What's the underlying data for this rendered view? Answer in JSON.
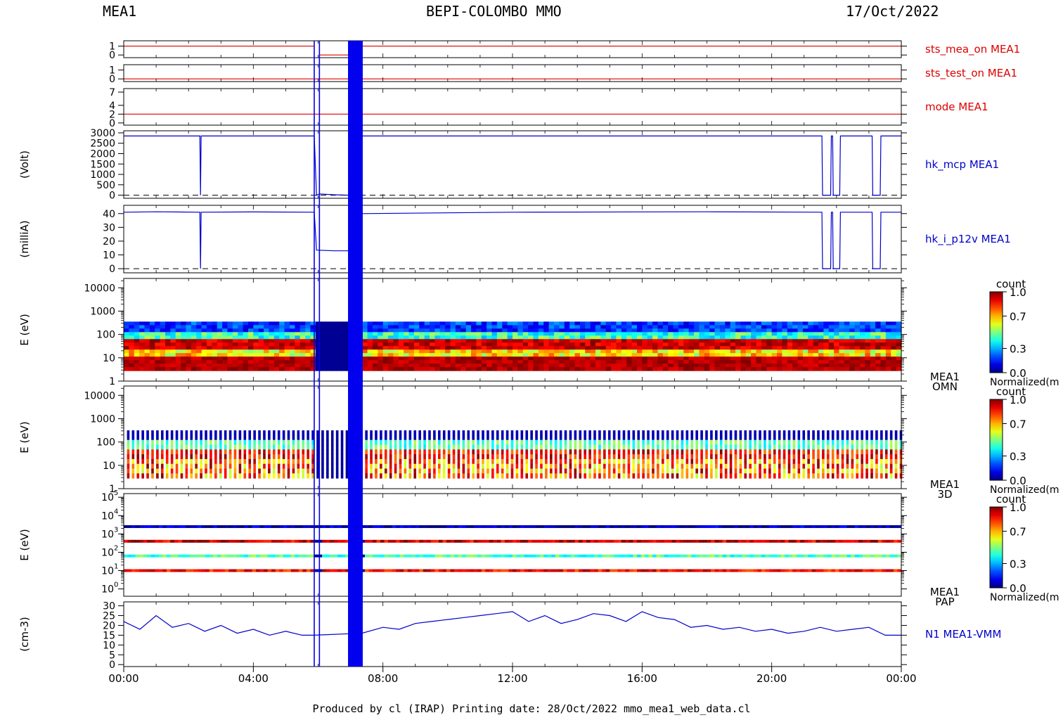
{
  "header": {
    "left": "MEA1",
    "center": "BEPI-COLOMBO MMO",
    "right": "17/Oct/2022"
  },
  "footer": {
    "text": "Produced by cl (IRAP)    Printing date: 28/Oct/2022    mmo_mea1_web_data.cl"
  },
  "colors": {
    "status_line": "#dd0000",
    "hk_line": "#0000cc",
    "event_marker": "#0000ee",
    "frame": "#000000"
  },
  "chart_data": {
    "type": "line",
    "x_axis": {
      "range_hours": [
        0,
        24
      ],
      "tick_hours": [
        0,
        4,
        8,
        12,
        16,
        20,
        24
      ],
      "tick_labels": [
        "00:00",
        "04:00",
        "08:00",
        "12:00",
        "16:00",
        "20:00",
        "00:00"
      ]
    },
    "event_markers_hours": [
      5.88,
      6.04,
      6.95,
      7.0,
      7.05,
      7.1,
      7.15,
      7.2,
      7.25,
      7.3,
      7.35
    ],
    "panels": [
      {
        "id": "sts_mea_on",
        "kind": "status",
        "label": "sts_mea_on MEA1",
        "label_color": "#dd0000",
        "ylabel": "",
        "ylim": [
          -0.3,
          1.6
        ],
        "ticks": [
          1,
          0
        ],
        "tick_labels": [
          "1",
          "0"
        ],
        "segments": [
          {
            "x": [
              0,
              5.88
            ],
            "y": 1
          },
          {
            "x": [
              6.04,
              6.95
            ],
            "y": 0
          },
          {
            "x": [
              7.35,
              24
            ],
            "y": 1
          }
        ]
      },
      {
        "id": "sts_test_on",
        "kind": "status",
        "label": "sts_test_on MEA1",
        "label_color": "#dd0000",
        "ylabel": "",
        "ylim": [
          -0.3,
          1.6
        ],
        "ticks": [
          1,
          0
        ],
        "tick_labels": [
          "1",
          "0"
        ],
        "segments": [
          {
            "x": [
              0,
              24
            ],
            "y": 0
          }
        ]
      },
      {
        "id": "mode",
        "kind": "status",
        "label": "mode MEA1",
        "label_color": "#dd0000",
        "ylabel": "",
        "ylim": [
          -0.5,
          7.8
        ],
        "ticks": [
          7,
          4,
          2,
          0
        ],
        "tick_labels": [
          "7",
          "4",
          "2",
          "0"
        ],
        "segments": [
          {
            "x": [
              0,
              24
            ],
            "y": 2
          }
        ]
      },
      {
        "id": "hk_mcp",
        "kind": "line",
        "label": "hk_mcp MEA1",
        "label_color": "#0000cc",
        "ylabel": "(Volt)",
        "ylim": [
          -150,
          3100
        ],
        "ticks": [
          3000,
          2500,
          2000,
          1500,
          1000,
          500,
          0
        ],
        "tick_labels": [
          "3000",
          "2500",
          "2000",
          "1500",
          "1000",
          "500",
          "0"
        ],
        "baseline": 0,
        "points": [
          [
            0,
            2850
          ],
          [
            2.35,
            2850
          ],
          [
            2.37,
            0
          ],
          [
            2.39,
            2850
          ],
          [
            5.88,
            2850
          ],
          [
            5.95,
            0
          ],
          [
            6.04,
            60
          ],
          [
            6.5,
            20
          ],
          [
            6.95,
            0
          ],
          [
            7.35,
            2850
          ],
          [
            21.55,
            2850
          ],
          [
            21.57,
            0
          ],
          [
            21.82,
            0
          ],
          [
            21.84,
            2850
          ],
          [
            21.88,
            2850
          ],
          [
            21.9,
            0
          ],
          [
            22.1,
            0
          ],
          [
            22.12,
            2850
          ],
          [
            23.1,
            2850
          ],
          [
            23.12,
            0
          ],
          [
            23.35,
            0
          ],
          [
            23.37,
            2850
          ],
          [
            24,
            2850
          ]
        ]
      },
      {
        "id": "hk_i_p12v",
        "kind": "line",
        "label": "hk_i_p12v MEA1",
        "label_color": "#0000cc",
        "ylabel": "(milliA)",
        "ylim": [
          -3,
          46
        ],
        "ticks": [
          40,
          30,
          20,
          10,
          0
        ],
        "tick_labels": [
          "40",
          "30",
          "20",
          "10",
          "0"
        ],
        "baseline": 0,
        "points": [
          [
            0,
            41
          ],
          [
            1,
            41.3
          ],
          [
            2.35,
            41
          ],
          [
            2.37,
            0
          ],
          [
            2.39,
            41
          ],
          [
            4,
            41.2
          ],
          [
            5.88,
            41
          ],
          [
            5.95,
            13.5
          ],
          [
            6.5,
            13
          ],
          [
            6.95,
            13
          ],
          [
            7.35,
            40
          ],
          [
            12,
            41
          ],
          [
            18,
            41.3
          ],
          [
            21.55,
            41
          ],
          [
            21.57,
            0
          ],
          [
            21.82,
            0
          ],
          [
            21.84,
            41
          ],
          [
            21.88,
            41
          ],
          [
            21.9,
            0
          ],
          [
            22.1,
            0
          ],
          [
            22.12,
            41
          ],
          [
            23.1,
            41
          ],
          [
            23.12,
            0
          ],
          [
            23.35,
            0
          ],
          [
            23.37,
            41
          ],
          [
            24,
            41
          ]
        ]
      },
      {
        "id": "omn",
        "kind": "spectrogram",
        "ylabel": "E (eV)",
        "side_label": [
          "MEA1",
          "OMN"
        ],
        "ylim_log10": [
          0,
          4.4
        ],
        "ticks_log10": [
          4,
          3,
          2,
          1,
          0
        ],
        "tick_labels": [
          "10000",
          "1000",
          "100",
          "10",
          "1"
        ],
        "energy_band_log10": [
          0.45,
          2.55
        ],
        "pattern": "continuous",
        "gap_hours": [
          5.88,
          7.35
        ]
      },
      {
        "id": "3d",
        "kind": "spectrogram",
        "ylabel": "E (eV)",
        "side_label": [
          "MEA1",
          "3D"
        ],
        "ylim_log10": [
          0,
          4.4
        ],
        "ticks_log10": [
          4,
          3,
          2,
          1,
          0
        ],
        "tick_labels": [
          "10000",
          "1000",
          "100",
          "10",
          "1"
        ],
        "energy_band_log10": [
          0.45,
          2.5
        ],
        "pattern": "stripes",
        "gap_hours": [
          5.88,
          7.35
        ]
      },
      {
        "id": "pap",
        "kind": "spectrogram",
        "ylabel": "E (eV)",
        "side_label": [
          "MEA1",
          "PAP"
        ],
        "ylim_log10": [
          -0.4,
          5.2
        ],
        "ticks_log10": [
          5,
          4,
          3,
          2,
          1,
          0
        ],
        "tick_labels": [
          "10",
          "10",
          "10",
          "10",
          "10",
          "10"
        ],
        "tick_exponents": [
          "5",
          "4",
          "3",
          "2",
          "1",
          "0"
        ],
        "bands_log10": [
          3.4,
          2.6,
          1.8,
          1.0
        ],
        "band_levels": [
          0.05,
          0.92,
          0.45,
          0.88
        ],
        "pattern": "bands"
      },
      {
        "id": "density",
        "kind": "line",
        "label": "N1 MEA1-VMM",
        "label_color": "#0000cc",
        "ylabel": "(cm-3)",
        "ylim": [
          -1,
          32
        ],
        "ticks": [
          30,
          25,
          20,
          15,
          10,
          5,
          0
        ],
        "tick_labels": [
          "30",
          "25",
          "20",
          "15",
          "10",
          "5",
          "0"
        ],
        "points": [
          [
            0,
            22
          ],
          [
            0.5,
            18
          ],
          [
            1,
            25
          ],
          [
            1.5,
            19
          ],
          [
            2,
            21
          ],
          [
            2.5,
            17
          ],
          [
            3,
            20
          ],
          [
            3.5,
            16
          ],
          [
            4,
            18
          ],
          [
            4.5,
            15
          ],
          [
            5,
            17
          ],
          [
            5.5,
            15
          ],
          [
            5.88,
            15
          ],
          [
            7.35,
            16
          ],
          [
            8,
            19
          ],
          [
            8.5,
            18
          ],
          [
            9,
            21
          ],
          [
            9.5,
            22
          ],
          [
            10,
            23
          ],
          [
            10.5,
            24
          ],
          [
            11,
            25
          ],
          [
            11.5,
            26
          ],
          [
            12,
            27
          ],
          [
            12.5,
            22
          ],
          [
            13,
            25
          ],
          [
            13.5,
            21
          ],
          [
            14,
            23
          ],
          [
            14.5,
            26
          ],
          [
            15,
            25
          ],
          [
            15.5,
            22
          ],
          [
            16,
            27
          ],
          [
            16.5,
            24
          ],
          [
            17,
            23
          ],
          [
            17.5,
            19
          ],
          [
            18,
            20
          ],
          [
            18.5,
            18
          ],
          [
            19,
            19
          ],
          [
            19.5,
            17
          ],
          [
            20,
            18
          ],
          [
            20.5,
            16
          ],
          [
            21,
            17
          ],
          [
            21.5,
            19
          ],
          [
            22,
            17
          ],
          [
            22.5,
            18
          ],
          [
            23,
            19
          ],
          [
            23.5,
            15
          ],
          [
            24,
            15
          ]
        ]
      }
    ],
    "colorbars": [
      {
        "panel": "omn",
        "title": "count",
        "tick_labels": [
          "1.0",
          "0.7",
          "0.3",
          "0.0"
        ],
        "bottom_label": "Normalized(m"
      },
      {
        "panel": "3d",
        "title": "count",
        "tick_labels": [
          "1.0",
          "0.7",
          "0.3",
          "0.0"
        ],
        "bottom_label": "Normalized(m"
      },
      {
        "panel": "pap",
        "title": "count",
        "tick_labels": [
          "1.0",
          "0.7",
          "0.3",
          "0.0"
        ],
        "bottom_label": "Normalized(m"
      }
    ]
  }
}
